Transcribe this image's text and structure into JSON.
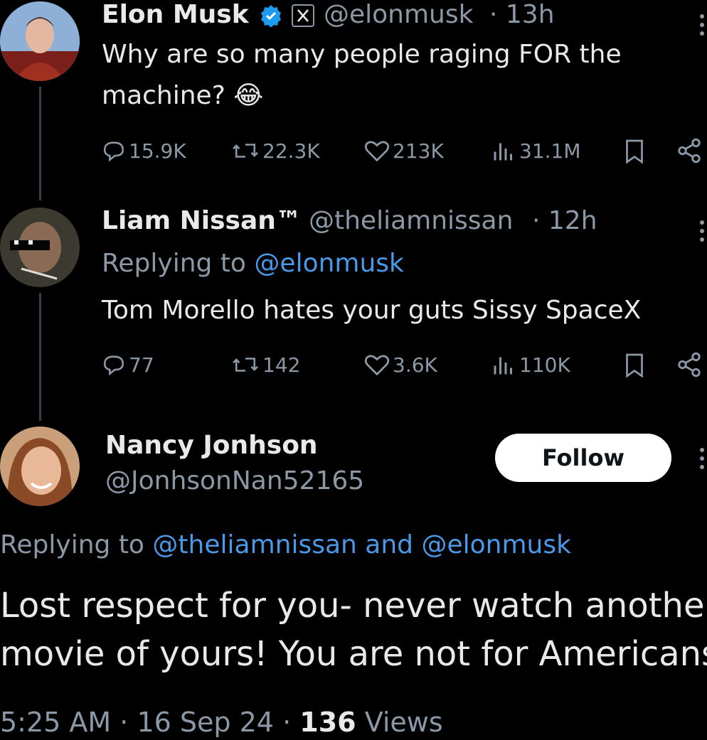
{
  "tweet1": {
    "name": "Elon Musk",
    "badge_icon": "verified-badge-icon",
    "org_icon": "x-logo-icon",
    "handle": "@elonmusk",
    "time": "· 13h",
    "text_line1": "Why are so many people raging FOR the",
    "text_line2": "machine?",
    "emoji": "😂",
    "replies": "15.9K",
    "reposts": "22.3K",
    "likes": "213K",
    "views": "31.1M"
  },
  "tweet2": {
    "name": "Liam Nissan™",
    "handle": "@theliamnissan",
    "time": "· 12h",
    "replying_prefix": "Replying to",
    "replying_to": "@elonmusk",
    "text": "Tom Morello hates your guts Sissy SpaceX",
    "replies": "77",
    "reposts": "142",
    "likes": "3.6K",
    "views": "110K"
  },
  "tweet3": {
    "name": "Nancy Jonhson",
    "handle": "@JonhsonNan52165",
    "follow_label": "Follow",
    "replying_prefix": "Replying to",
    "replying_to": "@theliamnissan and @elonmusk",
    "text_line1": "Lost respect for you- never watch another",
    "text_line2": "movie of yours!  You are not for Americans.",
    "time": "5:25 AM",
    "date": "16 Sep 24",
    "views_count": "136",
    "views_label": "Views"
  },
  "colors": {
    "background": "#000000",
    "link": "#4a99e9",
    "muted": "#8b98a5",
    "verified": "#1d9bf0"
  }
}
